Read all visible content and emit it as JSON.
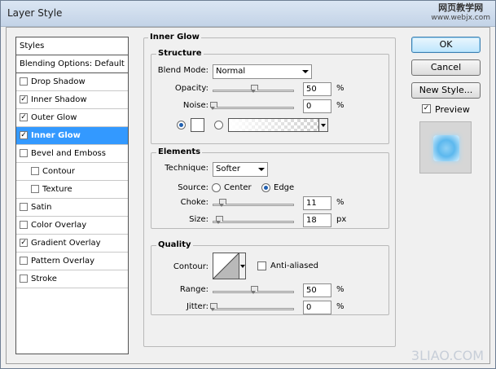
{
  "window": {
    "title": "Layer Style",
    "watermark_top_line1": "网页教学网",
    "watermark_top_line2": "www.webjx.com",
    "watermark_bottom": "3LIAO.COM"
  },
  "styles_list": {
    "header": "Styles",
    "blending": "Blending Options: Default",
    "items": [
      {
        "label": "Drop Shadow",
        "checked": false,
        "indent": false
      },
      {
        "label": "Inner Shadow",
        "checked": true,
        "indent": false
      },
      {
        "label": "Outer Glow",
        "checked": true,
        "indent": false
      },
      {
        "label": "Inner Glow",
        "checked": true,
        "indent": false,
        "selected": true
      },
      {
        "label": "Bevel and Emboss",
        "checked": false,
        "indent": false
      },
      {
        "label": "Contour",
        "checked": false,
        "indent": true
      },
      {
        "label": "Texture",
        "checked": false,
        "indent": true
      },
      {
        "label": "Satin",
        "checked": false,
        "indent": false
      },
      {
        "label": "Color Overlay",
        "checked": false,
        "indent": false
      },
      {
        "label": "Gradient Overlay",
        "checked": true,
        "indent": false
      },
      {
        "label": "Pattern Overlay",
        "checked": false,
        "indent": false
      },
      {
        "label": "Stroke",
        "checked": false,
        "indent": false
      }
    ]
  },
  "inner_glow": {
    "section_title": "Inner Glow",
    "structure": {
      "title": "Structure",
      "blend_mode_label": "Blend Mode:",
      "blend_mode_value": "Normal",
      "opacity_label": "Opacity:",
      "opacity_value": "50",
      "opacity_level": 0.5,
      "opacity_unit": "%",
      "noise_label": "Noise:",
      "noise_value": "0",
      "noise_level": 0,
      "noise_unit": "%"
    },
    "elements": {
      "title": "Elements",
      "technique_label": "Technique:",
      "technique_value": "Softer",
      "source_label": "Source:",
      "source_center": "Center",
      "source_edge": "Edge",
      "choke_label": "Choke:",
      "choke_value": "11",
      "choke_level": 0.11,
      "choke_unit": "%",
      "size_label": "Size:",
      "size_value": "18",
      "size_level": 0.07,
      "size_unit": "px"
    },
    "quality": {
      "title": "Quality",
      "contour_label": "Contour:",
      "anti_aliased_label": "Anti-aliased",
      "range_label": "Range:",
      "range_value": "50",
      "range_level": 0.5,
      "range_unit": "%",
      "jitter_label": "Jitter:",
      "jitter_value": "0",
      "jitter_level": 0,
      "jitter_unit": "%"
    }
  },
  "buttons": {
    "ok": "OK",
    "cancel": "Cancel",
    "new_style": "New Style...",
    "preview_label": "Preview",
    "check_mark": "✓"
  },
  "colors": {
    "selection": "#3399ff",
    "preview_glow": "#5cb8ee"
  }
}
